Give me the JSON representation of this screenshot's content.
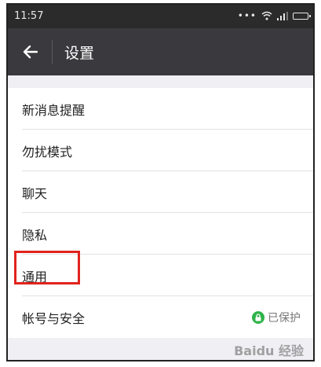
{
  "status_bar": {
    "time": "11:57",
    "icons": [
      "more-dots-icon",
      "wifi-icon",
      "signal-icon",
      "battery-icon"
    ]
  },
  "app_bar": {
    "title": "设置",
    "back_icon": "arrow-left-icon"
  },
  "settings_items": [
    {
      "label": "新消息提醒"
    },
    {
      "label": "勿扰模式"
    },
    {
      "label": "聊天"
    },
    {
      "label": "隐私"
    },
    {
      "label": "通用",
      "highlighted": true
    },
    {
      "label": "帐号与安全",
      "status": "已保护",
      "status_icon": "lock-icon",
      "status_color": "#2fb349"
    }
  ],
  "watermark": "Baidu 经验",
  "colors": {
    "app_bar": "#3a3a3e",
    "status_bar": "#2b2b2b",
    "highlight": "#e0231d",
    "background": "#efeff4"
  }
}
